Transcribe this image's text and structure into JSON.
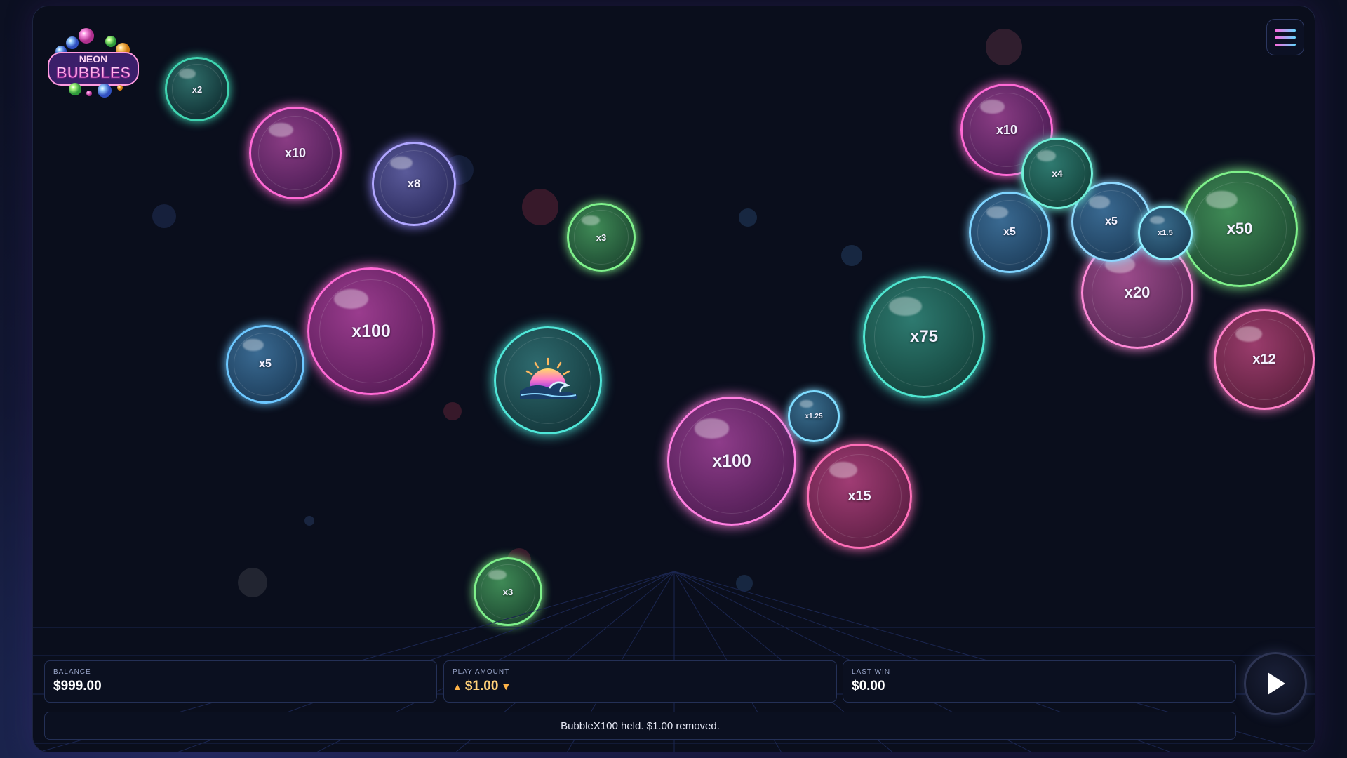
{
  "game": {
    "logo_line1": "NEON",
    "logo_line2": "BUBBLES"
  },
  "bubbles": [
    {
      "label": "x2",
      "color": "#3fd4b0"
    },
    {
      "label": "x10",
      "color": "#ff6ad5"
    },
    {
      "label": "x8",
      "color": "#9a8cff"
    },
    {
      "label": "x3",
      "color": "#7ef08a"
    },
    {
      "label": "x100",
      "color": "#ff6ad5"
    },
    {
      "label": "x5",
      "color": "#6cc7ff"
    },
    {
      "label": "",
      "color": "#4fe6d8",
      "icon": "sunset-wave-icon"
    },
    {
      "label": "x100",
      "color": "#ff7fe0"
    },
    {
      "label": "x1.25",
      "color": "#7fdcff"
    },
    {
      "label": "x15",
      "color": "#ff6fb8"
    },
    {
      "label": "x3",
      "color": "#7ef08a"
    },
    {
      "label": "x75",
      "color": "#4fe6d0"
    },
    {
      "label": "x10",
      "color": "#ff6ad5"
    },
    {
      "label": "x4",
      "color": "#6ff0d8"
    },
    {
      "label": "x5",
      "color": "#7fd4ff"
    },
    {
      "label": "x5",
      "color": "#8fd8ff"
    },
    {
      "label": "x1.5",
      "color": "#8ff0ff"
    },
    {
      "label": "x50",
      "color": "#7ef08a"
    },
    {
      "label": "x20",
      "color": "#ff8ad8"
    },
    {
      "label": "x12",
      "color": "#ff7fc8"
    }
  ],
  "hud": {
    "balance_label": "BALANCE",
    "balance_value": "$999.00",
    "play_label": "PLAY AMOUNT",
    "play_value": "$1.00",
    "up_arrow": "▲",
    "down_arrow": "▼",
    "last_win_label": "LAST WIN",
    "last_win_value": "$0.00",
    "message": "BubbleX100 held. $1.00 removed."
  },
  "colors": {
    "accent_gold": "#ffd078",
    "panel_border": "#243056",
    "background": "#0a0e1c"
  }
}
